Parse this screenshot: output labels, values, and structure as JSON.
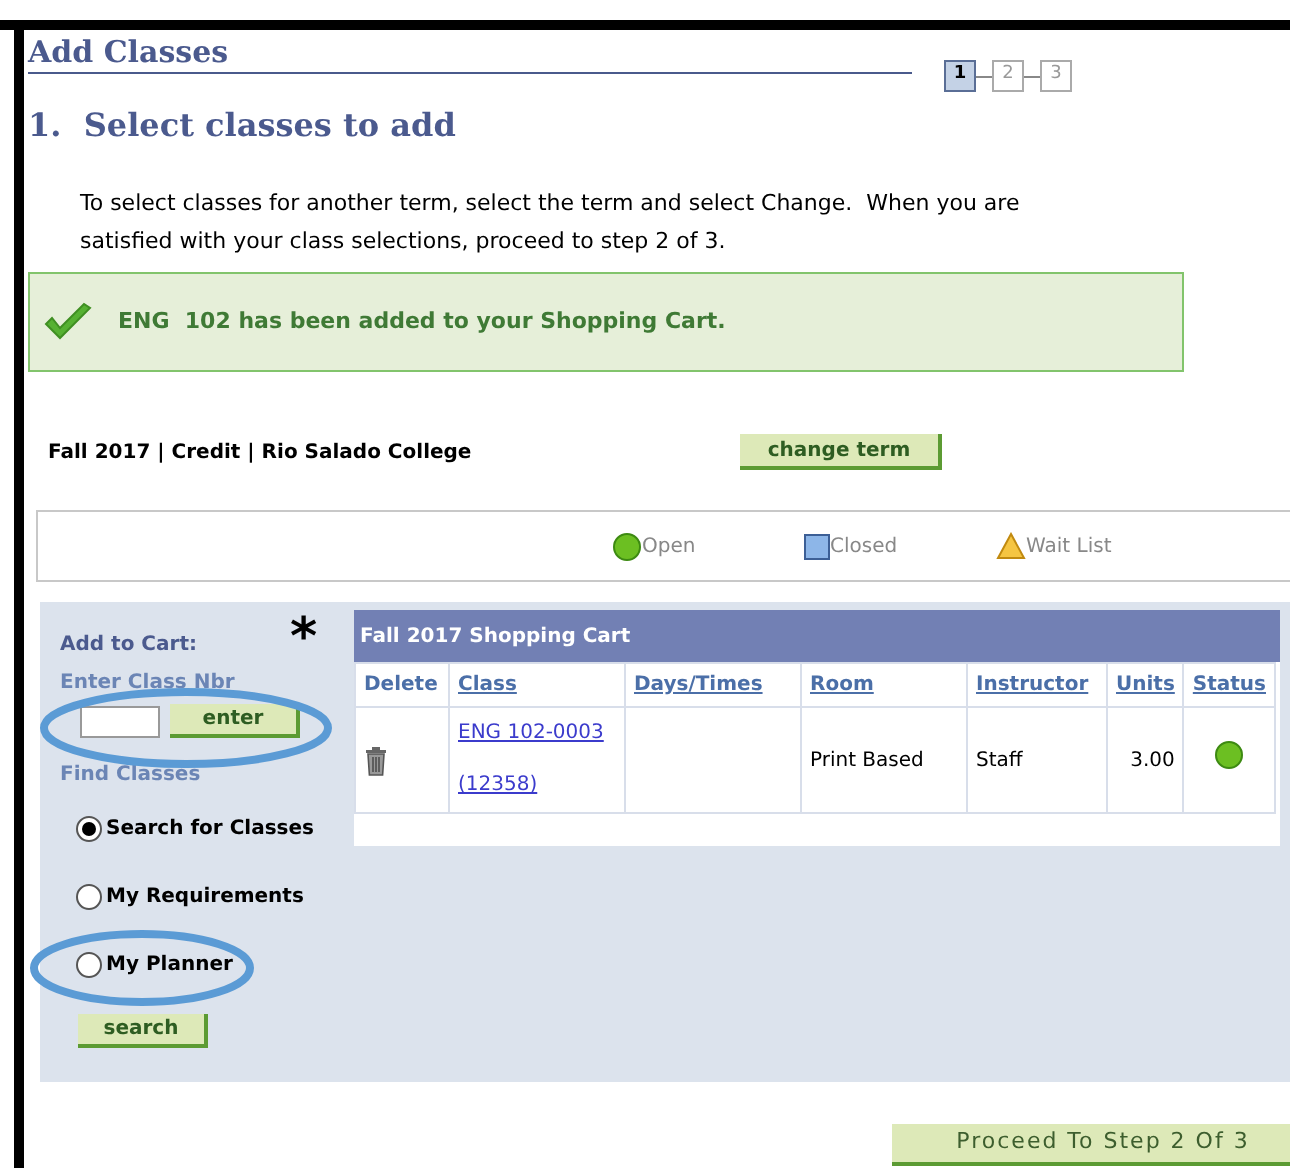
{
  "title": "Add Classes",
  "steps": [
    {
      "label": "1",
      "selected": true
    },
    {
      "label": "2",
      "selected": false
    },
    {
      "label": "3",
      "selected": false
    }
  ],
  "heading": "1.  Select classes to add",
  "instructions": "To select classes for another term, select the term and select Change.  When you are satisfied with your class selections, proceed to step 2 of 3.",
  "message": "ENG  102 has been added to your Shopping Cart.",
  "term_info": "Fall 2017 | Credit | Rio Salado College",
  "change_term_button": "change term",
  "legend": [
    {
      "kind": "open",
      "label": "Open"
    },
    {
      "kind": "closed",
      "label": "Closed"
    },
    {
      "kind": "waitlist",
      "label": "Wait List"
    }
  ],
  "add_to_cart": {
    "label": "Add to Cart:",
    "field_label": "Enter Class Nbr",
    "button": "enter"
  },
  "find_classes": {
    "label": "Find Classes",
    "options": [
      {
        "label": "Search for Classes",
        "selected": true
      },
      {
        "label": "My Requirements",
        "selected": false
      },
      {
        "label": "My Planner",
        "selected": false
      }
    ],
    "button": "search"
  },
  "cart": {
    "title": "Fall 2017 Shopping Cart",
    "columns": [
      "Delete",
      "Class",
      "Days/Times",
      "Room",
      "Instructor",
      "Units",
      "Status"
    ],
    "rows": [
      {
        "class": "ENG 102-0003 (12358)",
        "room": "Print Based",
        "instructor": "Staff",
        "units": "3.00",
        "status": {
          "kind": "open"
        }
      }
    ]
  },
  "annotation": "*",
  "proceed_button": "Proceed To Step 2 Of 3"
}
